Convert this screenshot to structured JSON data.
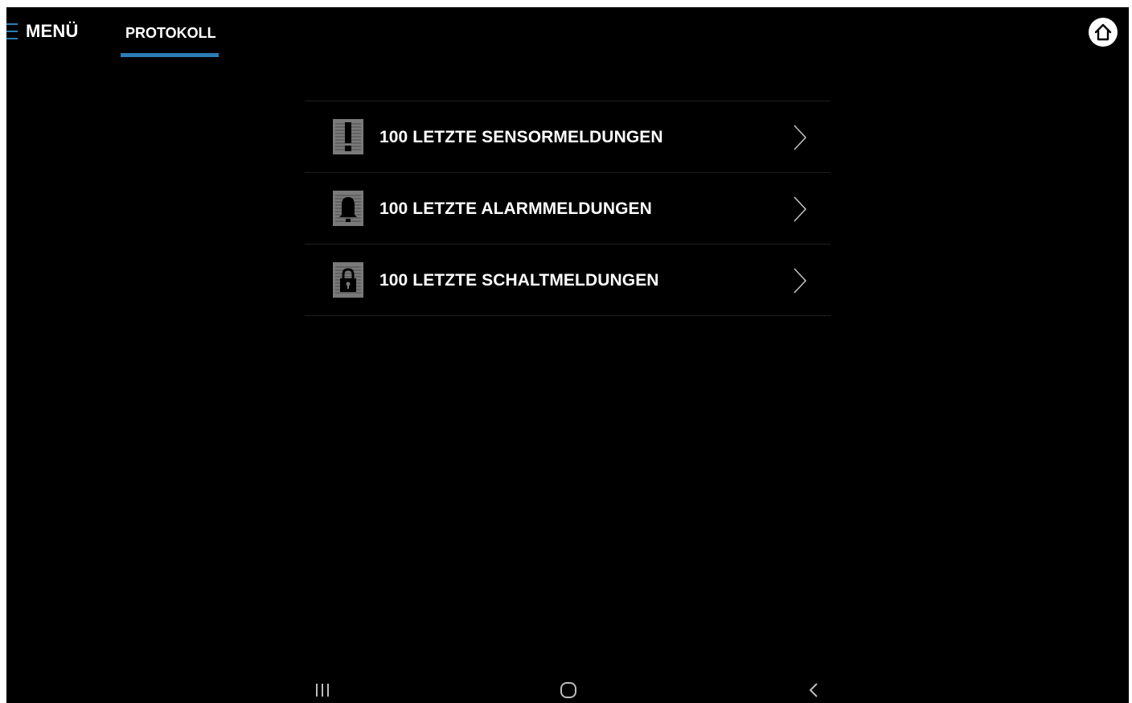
{
  "header": {
    "menu_label": "MENÜ",
    "tabs": [
      {
        "label": "PROTOKOLL",
        "active": true
      }
    ],
    "accent_color": "#2c7cb5"
  },
  "list": {
    "items": [
      {
        "label": "100 LETZTE SENSORMELDUNGEN",
        "icon": "exclamation-icon"
      },
      {
        "label": "100 LETZTE ALARMMELDUNGEN",
        "icon": "bell-icon"
      },
      {
        "label": "100 LETZTE SCHALTMELDUNGEN",
        "icon": "lock-icon"
      }
    ]
  },
  "navbar": {
    "icons": [
      "recent-apps-icon",
      "home-circle-icon",
      "back-icon"
    ]
  }
}
